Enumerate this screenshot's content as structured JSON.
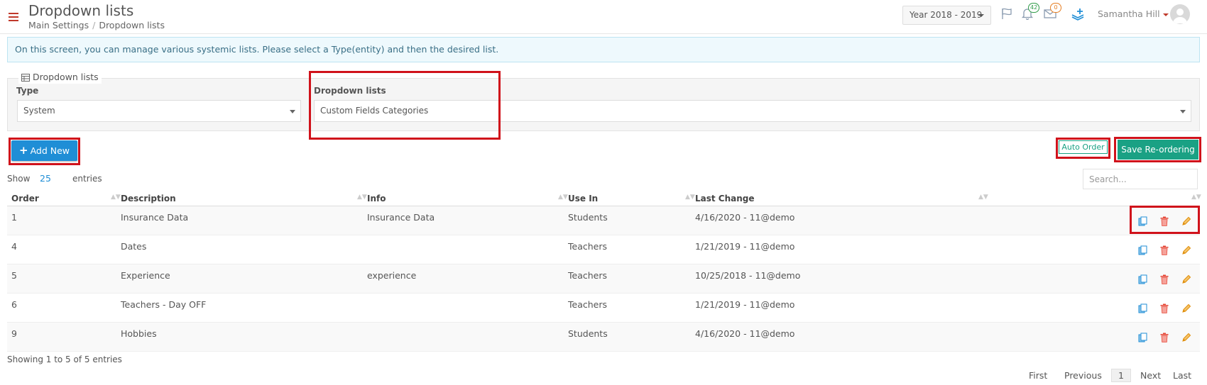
{
  "header": {
    "title": "Dropdown lists",
    "breadcrumb": [
      "Main Settings",
      "Dropdown lists"
    ],
    "year_selector": "Year 2018 - 2019",
    "notifications_count": "42",
    "messages_count": "0",
    "user_name": "Samantha Hill"
  },
  "info_message": "On this screen, you can manage various systemic lists. Please select a Type(entity) and then the desired list.",
  "filter": {
    "legend": "Dropdown lists",
    "type_label": "Type",
    "type_value": "System",
    "list_label": "Dropdown lists",
    "list_value": "Custom Fields Categories"
  },
  "toolbar": {
    "add_new_label": "Add New",
    "auto_order_label": "Auto Order",
    "save_reordering_label": "Save Re-ordering"
  },
  "table_controls": {
    "show_label": "Show",
    "page_size": "25",
    "entries_label": "entries",
    "search_placeholder": "Search..."
  },
  "table": {
    "columns": [
      "Order",
      "Description",
      "Info",
      "Use In",
      "Last Change"
    ],
    "rows": [
      {
        "order": "1",
        "description": "Insurance Data",
        "info": "Insurance Data",
        "use_in": "Students",
        "last_change": "4/16/2020 - 11@demo"
      },
      {
        "order": "4",
        "description": "Dates",
        "info": "",
        "use_in": "Teachers",
        "last_change": "1/21/2019 - 11@demo"
      },
      {
        "order": "5",
        "description": "Experience",
        "info": "experience",
        "use_in": "Teachers",
        "last_change": "10/25/2018 - 11@demo"
      },
      {
        "order": "6",
        "description": "Teachers - Day OFF",
        "info": "",
        "use_in": "Teachers",
        "last_change": "1/21/2019 - 11@demo"
      },
      {
        "order": "9",
        "description": "Hobbies",
        "info": "",
        "use_in": "Students",
        "last_change": "4/16/2020 - 11@demo"
      }
    ]
  },
  "footer": {
    "showing_text": "Showing 1 to 5 of 5 entries",
    "pagination": {
      "first": "First",
      "previous": "Previous",
      "current": "1",
      "next": "Next",
      "last": "Last"
    }
  },
  "colors": {
    "accent_blue": "#1f8ed6",
    "accent_green": "#1aa184",
    "delete_red": "#e74c3c",
    "edit_orange": "#f39c12",
    "highlight_red": "#d0121b"
  }
}
